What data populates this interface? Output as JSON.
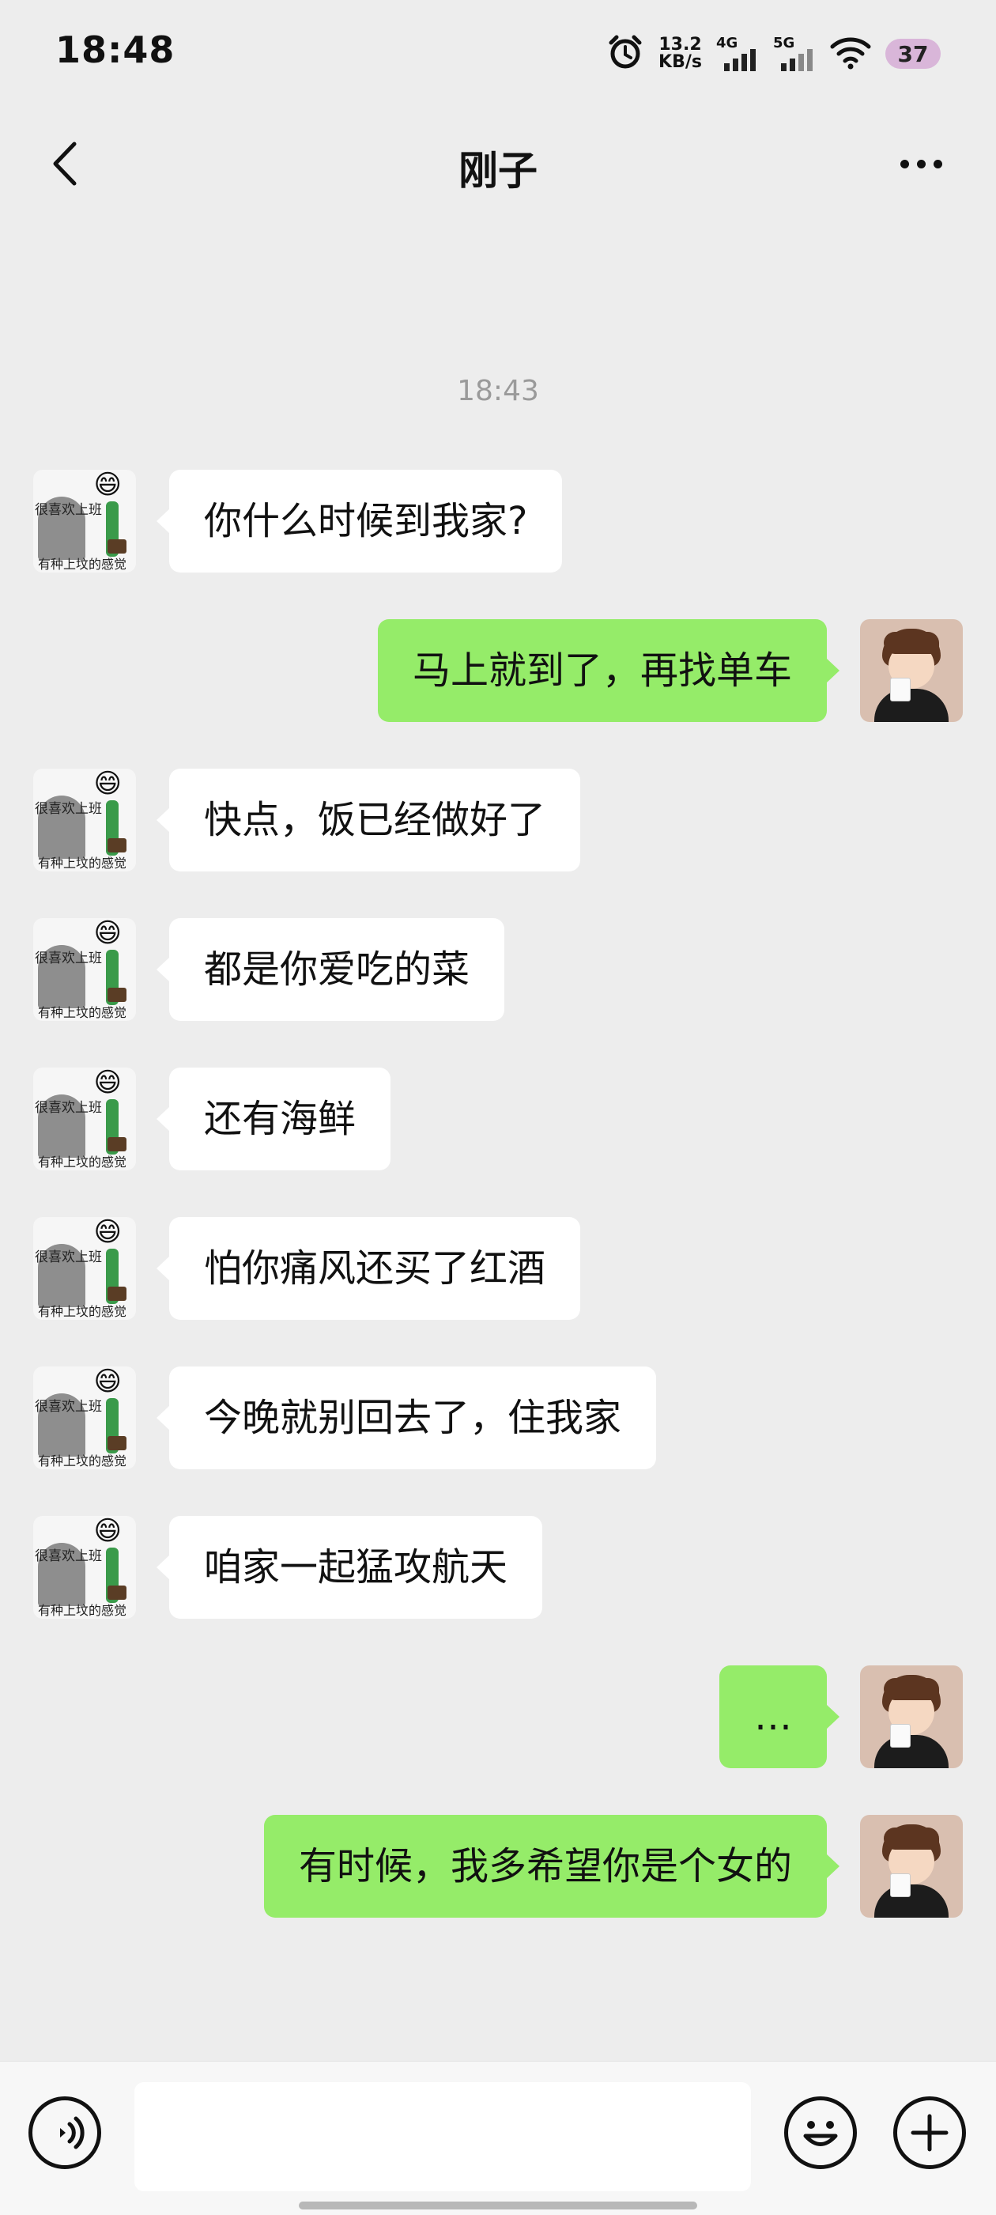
{
  "status_bar": {
    "time": "18:48",
    "net_speed_value": "13.2",
    "net_speed_unit": "KB/s",
    "sim1_label": "4G",
    "sim2_label": "5G",
    "battery": "37"
  },
  "header": {
    "title": "刚子"
  },
  "timestamp": "18:43",
  "incoming_avatar_text": {
    "line1": "很喜欢上班",
    "line2": "有种上坟的感觉"
  },
  "messages": [
    {
      "side": "in",
      "text": "你什么时候到我家?"
    },
    {
      "side": "out",
      "text": "马上就到了，再找单车"
    },
    {
      "side": "in",
      "text": "快点，饭已经做好了"
    },
    {
      "side": "in",
      "text": "都是你爱吃的菜"
    },
    {
      "side": "in",
      "text": "还有海鲜"
    },
    {
      "side": "in",
      "text": "怕你痛风还买了红酒"
    },
    {
      "side": "in",
      "text": "今晚就别回去了，住我家"
    },
    {
      "side": "in",
      "text": "咱家一起猛攻航天"
    },
    {
      "side": "out",
      "text": "…"
    },
    {
      "side": "out",
      "text": "有时候，我多希望你是个女的"
    }
  ],
  "colors": {
    "background": "#ededed",
    "incoming_bubble": "#ffffff",
    "outgoing_bubble": "#95ec69",
    "battery_pill": "#d9b6d9"
  },
  "icons": [
    "alarm-icon",
    "signal-icon",
    "wifi-icon",
    "back-icon",
    "more-icon",
    "voice-icon",
    "emoji-icon",
    "plus-icon"
  ]
}
